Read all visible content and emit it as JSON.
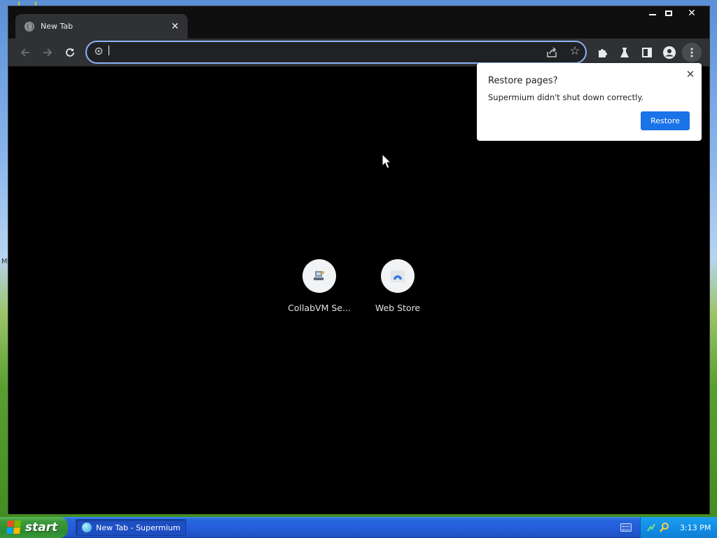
{
  "browser": {
    "tab": {
      "title": "New Tab"
    },
    "omnibox": {
      "value": "",
      "placeholder": ""
    },
    "accent_color": "#8ab4f8"
  },
  "shortcuts": [
    {
      "label": "CollabVM Se...",
      "icon": "collabvm-icon"
    },
    {
      "label": "Web Store",
      "icon": "web-store-icon"
    }
  ],
  "restore_popup": {
    "title": "Restore pages?",
    "message": "Supermium didn't shut down correctly.",
    "button_label": "Restore",
    "button_color": "#1a73e8"
  },
  "taskbar": {
    "start_label": "start",
    "items": [
      {
        "label": "New Tab - Supermium"
      }
    ],
    "clock": "3:13 PM"
  }
}
